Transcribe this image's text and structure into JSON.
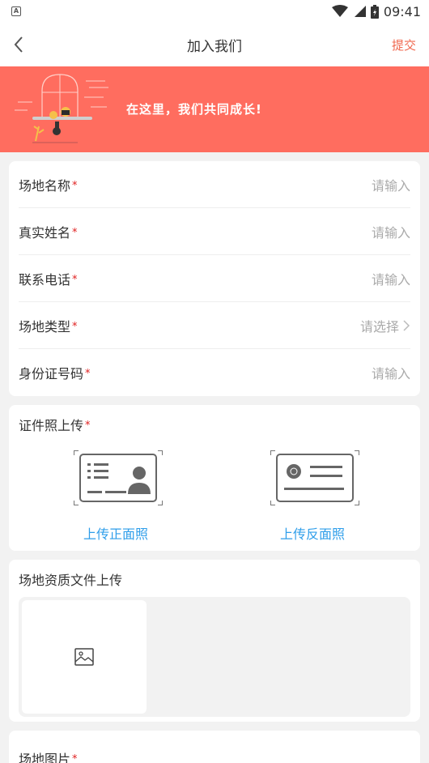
{
  "status_bar": {
    "time": "09:41",
    "notification_letter": "A"
  },
  "nav": {
    "title": "加入我们",
    "submit_label": "提交"
  },
  "banner": {
    "slogan": "在这里，我们共同成长!"
  },
  "form": {
    "required_mark": "*",
    "rows": [
      {
        "label": "场地名称",
        "placeholder": "请输入",
        "type": "input"
      },
      {
        "label": "真实姓名",
        "placeholder": "请输入",
        "type": "input"
      },
      {
        "label": "联系电话",
        "placeholder": "请输入",
        "type": "input"
      },
      {
        "label": "场地类型",
        "placeholder": "请选择",
        "type": "select"
      },
      {
        "label": "身份证号码",
        "placeholder": "请输入",
        "type": "input"
      }
    ]
  },
  "id_upload": {
    "title": "证件照上传",
    "front_label": "上传正面照",
    "back_label": "上传反面照"
  },
  "qualification_upload": {
    "title": "场地资质文件上传"
  },
  "venue_images": {
    "title": "场地图片"
  },
  "icons": {
    "back": "chevron-left-icon",
    "select_arrow": "chevron-right-icon",
    "upload_placeholder": "image-icon"
  },
  "colors": {
    "accent": "#ff6d5f",
    "submit": "#f0684f",
    "link_blue": "#2f9eea",
    "required": "#e02020"
  }
}
